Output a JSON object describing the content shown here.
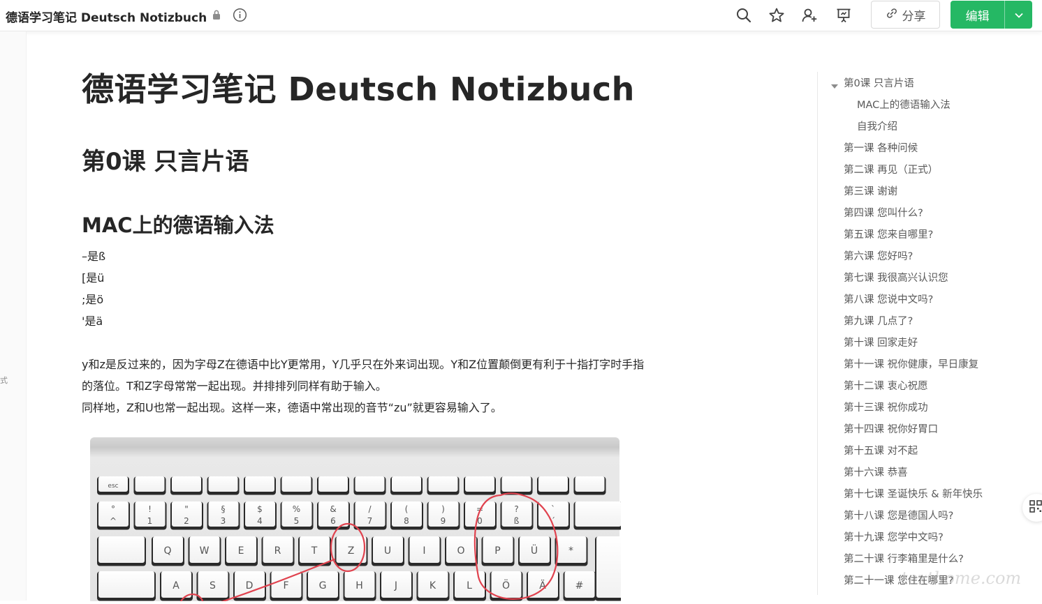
{
  "header": {
    "doc_title": "德语学习笔记 Deutsch Notizbuch",
    "share_label": "分享",
    "edit_label": "编辑",
    "accent_color": "#25b864"
  },
  "gutter": {
    "fragment": "式"
  },
  "content": {
    "title": "德语学习笔记 Deutsch Notizbuch",
    "lesson_heading": "第0课  只言片语",
    "section_heading": "MAC上的德语输入法",
    "mappings": [
      "–是ß",
      "[是ü",
      ";是ö",
      "'是ä"
    ],
    "paragraph_lines": [
      "y和z是反过来的，因为字母Z在德语中比Y更常用，Y几乎只在外来词出现。Y和Z位置颠倒更有利于十指打字时手指",
      "的落位。T和Z字母常常一起出现。并排排列同样有助于输入。",
      "同样地，Z和U也常一起出现。这样一来，德语中常出现的音节“zu”就更容易输入了。"
    ]
  },
  "keyboard": {
    "fn_row": [
      "esc",
      "",
      "",
      "",
      "",
      "",
      "",
      "",
      "",
      "",
      "",
      "",
      "",
      ""
    ],
    "num_row": [
      {
        "top": "°",
        "bottom": "^"
      },
      {
        "top": "!",
        "bottom": "1"
      },
      {
        "top": "\"",
        "bottom": "2"
      },
      {
        "top": "§",
        "bottom": "3"
      },
      {
        "top": "$",
        "bottom": "4"
      },
      {
        "top": "%",
        "bottom": "5"
      },
      {
        "top": "&",
        "bottom": "6"
      },
      {
        "top": "/",
        "bottom": "7"
      },
      {
        "top": "(",
        "bottom": "8"
      },
      {
        "top": ")",
        "bottom": "9"
      },
      {
        "top": "=",
        "bottom": "0"
      },
      {
        "top": "?",
        "bottom": "ß"
      },
      {
        "top": "`",
        "bottom": "´"
      }
    ],
    "row_q": [
      "Q",
      "W",
      "E",
      "R",
      "T",
      "Z",
      "U",
      "I",
      "O",
      "P",
      "Ü",
      "*"
    ],
    "row_a": [
      "A",
      "S",
      "D",
      "F",
      "G",
      "H",
      "J",
      "K",
      "L",
      "Ö",
      "Ä",
      "#"
    ],
    "sub_e": "€",
    "sub_l": "@",
    "sub_plus": "+"
  },
  "toc": {
    "items": [
      {
        "label": "第0课 只言片语",
        "level": 0
      },
      {
        "label": "MAC上的德语输入法",
        "level": 1
      },
      {
        "label": "自我介绍",
        "level": 1
      },
      {
        "label": "第一课  各种问候",
        "level": 0
      },
      {
        "label": "第二课 再见（正式）",
        "level": 0
      },
      {
        "label": "第三课 谢谢",
        "level": 0
      },
      {
        "label": "第四课  您叫什么?",
        "level": 0
      },
      {
        "label": "第五课 您来自哪里?",
        "level": 0
      },
      {
        "label": "第六课 您好吗?",
        "level": 0
      },
      {
        "label": "第七课 我很高兴认识您",
        "level": 0
      },
      {
        "label": "第八课 您说中文吗?",
        "level": 0
      },
      {
        "label": "第九课 几点了?",
        "level": 0
      },
      {
        "label": "第十课 回家走好",
        "level": 0
      },
      {
        "label": "第十一课 祝你健康，早日康复",
        "level": 0
      },
      {
        "label": "第十二课 衷心祝愿",
        "level": 0
      },
      {
        "label": "第十三课 祝你成功",
        "level": 0
      },
      {
        "label": "第十四课 祝你好胃口",
        "level": 0
      },
      {
        "label": "第十五课 对不起",
        "level": 0
      },
      {
        "label": "第十六课 恭喜",
        "level": 0
      },
      {
        "label": "第十七课 圣诞快乐 & 新年快乐",
        "level": 0
      },
      {
        "label": "第十八课 您是德国人吗?",
        "level": 0
      },
      {
        "label": "第十九课 您学中文吗?",
        "level": 0
      },
      {
        "label": "第二十课 行李箱里是什么?",
        "level": 0
      },
      {
        "label": "第二十一课 您住在哪里?",
        "level": 0
      }
    ]
  },
  "watermark": "texthome.com"
}
